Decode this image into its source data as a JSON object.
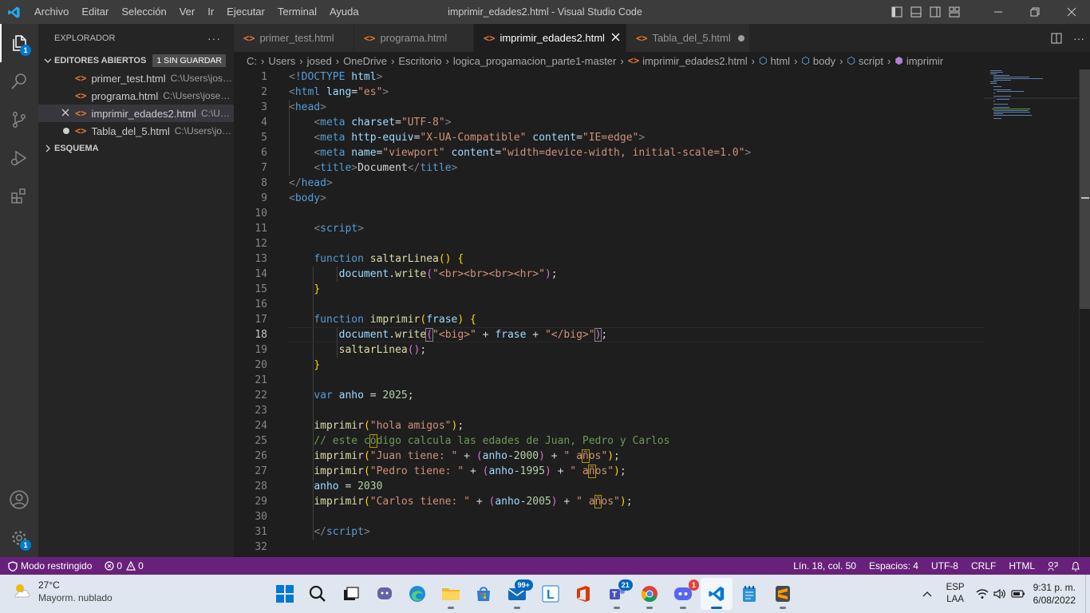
{
  "window": {
    "title": "imprimir_edades2.html - Visual Studio Code",
    "menu": [
      "Archivo",
      "Editar",
      "Selección",
      "Ver",
      "Ir",
      "Ejecutar",
      "Terminal",
      "Ayuda"
    ]
  },
  "activity_bar": {
    "explorer_badge": "1",
    "settings_badge": "1"
  },
  "sidebar": {
    "title": "EXPLORADOR",
    "more": "···",
    "open_editors": {
      "label": "EDITORES ABIERTOS",
      "badge": "1 SIN GUARDAR",
      "items": [
        {
          "name": "primer_test.html",
          "path": "C:\\Users\\jose..."
        },
        {
          "name": "programa.html",
          "path": "C:\\Users\\josed\\..."
        },
        {
          "name": "imprimir_edades2.html",
          "path": "C:\\Use..."
        },
        {
          "name": "Tabla_del_5.html",
          "path": "C:\\Users\\jose..."
        }
      ]
    },
    "outline_label": "ESQUEMA"
  },
  "tabs": [
    {
      "label": "primer_test.html"
    },
    {
      "label": "programa.html"
    },
    {
      "label": "imprimir_edades2.html"
    },
    {
      "label": "Tabla_del_5.html"
    }
  ],
  "breadcrumb": {
    "parts": [
      "C:",
      "Users",
      "josed",
      "OneDrive",
      "Escritorio",
      "logica_progamacion_parte1-master"
    ],
    "file": "imprimir_edades2.html",
    "symbols": [
      "html",
      "body",
      "script",
      "imprimir"
    ]
  },
  "editor": {
    "line_numbers": [
      "1",
      "2",
      "3",
      "4",
      "5",
      "6",
      "7",
      "8",
      "9",
      "10",
      "11",
      "12",
      "13",
      "14",
      "15",
      "16",
      "17",
      "18",
      "19",
      "20",
      "21",
      "22",
      "23",
      "24",
      "25",
      "26",
      "27",
      "28",
      "29",
      "30",
      "31",
      "32"
    ],
    "current_line": "18"
  },
  "status_bar": {
    "restricted": "Modo restringido",
    "errors": "0",
    "warnings": "0",
    "position": "Lín. 18, col. 50",
    "spaces": "Espacios: 4",
    "encoding": "UTF-8",
    "eol": "CRLF",
    "language": "HTML"
  },
  "taskbar": {
    "weather_temp": "27°C",
    "weather_desc": "Mayorm. nublado",
    "mail_badge": "99+",
    "teams_badge": "21",
    "discord_badge": "1",
    "lang_top": "ESP",
    "lang_bottom": "LAA",
    "time": "9:31 p. m.",
    "date": "6/08/2022"
  },
  "colors": {
    "status_bar": "#68217a",
    "accent": "#007acc",
    "html_icon": "#e37933"
  }
}
